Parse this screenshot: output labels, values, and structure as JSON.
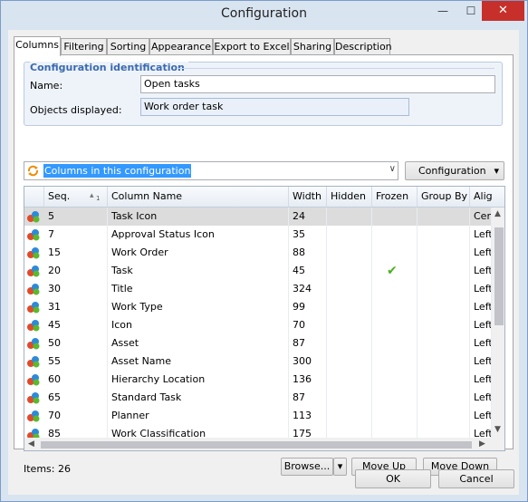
{
  "window": {
    "title": "Configuration",
    "minimize_glyph": "—",
    "maximize_glyph": "☐",
    "close_glyph": "✕"
  },
  "tabs": [
    {
      "label": "Columns",
      "active": true
    },
    {
      "label": "Filtering"
    },
    {
      "label": "Sorting"
    },
    {
      "label": "Appearance"
    },
    {
      "label": "Export to Excel"
    },
    {
      "label": "Sharing"
    },
    {
      "label": "Description"
    }
  ],
  "identification": {
    "group_title": "Configuration identification",
    "name_label": "Name:",
    "name_value": "Open tasks",
    "objects_label": "Objects displayed:",
    "objects_value": "Work order task"
  },
  "config_combo": {
    "selected": "Columns in this configuration",
    "icon": "refresh-icon",
    "arrow": "∨"
  },
  "config_button": {
    "label": "Configuration",
    "arrow": "▾"
  },
  "grid": {
    "columns": [
      "",
      "Seq.",
      "Column Name",
      "Width",
      "Hidden",
      "Frozen",
      "Group By",
      "Alig"
    ],
    "sort_indicator": "▴",
    "sort_index": "1",
    "rows": [
      {
        "seq": "5",
        "name": "Task Icon",
        "width": "24",
        "hidden": "",
        "frozen": false,
        "group": "",
        "align": "Cent",
        "selected": true
      },
      {
        "seq": "7",
        "name": "Approval Status Icon",
        "width": "35",
        "hidden": "",
        "frozen": false,
        "group": "",
        "align": "Left"
      },
      {
        "seq": "15",
        "name": "Work Order",
        "width": "88",
        "hidden": "",
        "frozen": false,
        "group": "",
        "align": "Left"
      },
      {
        "seq": "20",
        "name": "Task",
        "width": "45",
        "hidden": "",
        "frozen": true,
        "group": "",
        "align": "Left"
      },
      {
        "seq": "30",
        "name": "Title",
        "width": "324",
        "hidden": "",
        "frozen": false,
        "group": "",
        "align": "Left"
      },
      {
        "seq": "31",
        "name": "Work Type",
        "width": "99",
        "hidden": "",
        "frozen": false,
        "group": "",
        "align": "Left"
      },
      {
        "seq": "45",
        "name": "Icon",
        "width": "70",
        "hidden": "",
        "frozen": false,
        "group": "",
        "align": "Left"
      },
      {
        "seq": "50",
        "name": "Asset",
        "width": "87",
        "hidden": "",
        "frozen": false,
        "group": "",
        "align": "Left"
      },
      {
        "seq": "55",
        "name": "Asset Name",
        "width": "300",
        "hidden": "",
        "frozen": false,
        "group": "",
        "align": "Left"
      },
      {
        "seq": "60",
        "name": "Hierarchy Location",
        "width": "136",
        "hidden": "",
        "frozen": false,
        "group": "",
        "align": "Left"
      },
      {
        "seq": "65",
        "name": "Standard Task",
        "width": "87",
        "hidden": "",
        "frozen": false,
        "group": "",
        "align": "Left"
      },
      {
        "seq": "70",
        "name": "Planner",
        "width": "113",
        "hidden": "",
        "frozen": false,
        "group": "",
        "align": "Left"
      },
      {
        "seq": "85",
        "name": "Work Classification",
        "width": "175",
        "hidden": "",
        "frozen": false,
        "group": "",
        "align": "Left"
      }
    ],
    "frozen_glyph": "✔"
  },
  "footer": {
    "items_label": "Items: 26",
    "browse_label": "Browse...",
    "browse_arrow": "▾",
    "move_up_label": "Move Up",
    "move_down_label": "Move Down",
    "ok_label": "OK",
    "cancel_label": "Cancel"
  },
  "colors": {
    "accent": "#3a6ab0",
    "selection": "#3399ff",
    "close": "#c7302a",
    "frozen_check": "#4caf20"
  }
}
